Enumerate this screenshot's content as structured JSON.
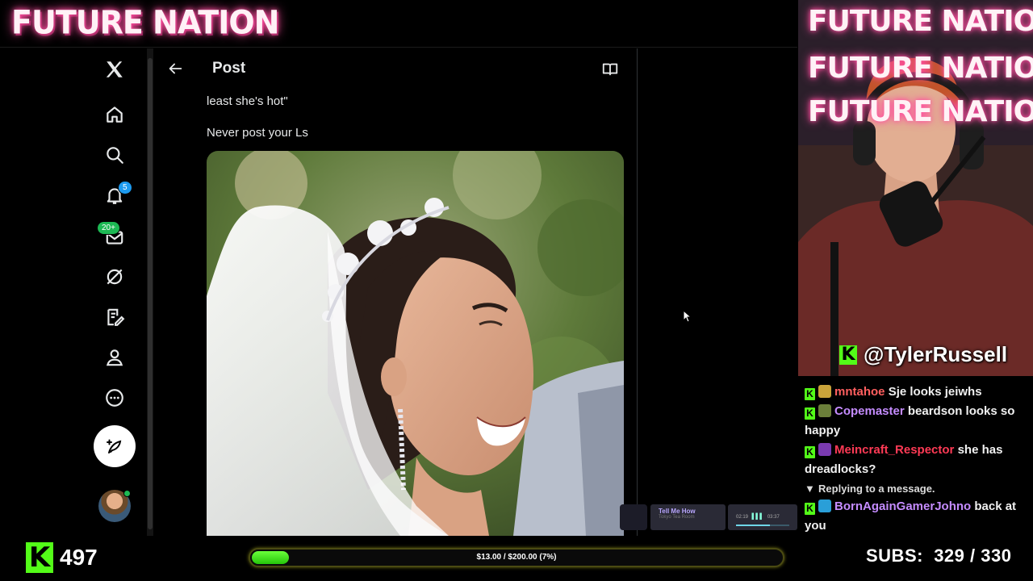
{
  "overlay": {
    "brand": "FUTURE NATION",
    "webcam_titles": [
      "FUTURE NATION",
      "FUTURE NATION",
      "FUTURE NATION"
    ],
    "streamer_handle": "@TylerRussell",
    "kick_followers": "497",
    "goal_text": "$13.00 / $200.00 (7%)",
    "goal_progress": 0.07,
    "subs_label": "SUBS:",
    "subs_value": "329 / 330",
    "accent_green": "#53fc18"
  },
  "nav": {
    "notifications_badge": "5",
    "messages_badge": "20+",
    "icons": [
      "x-logo-icon",
      "home-icon",
      "search-icon",
      "bell-icon",
      "mail-icon",
      "grok-icon",
      "edit-list-icon",
      "profile-icon",
      "more-icon",
      "compose-icon"
    ]
  },
  "post": {
    "title": "Post",
    "quote_text": "least she's hot\"",
    "body_text": "Never post your Ls"
  },
  "chat": {
    "messages": [
      {
        "user": "mntahoe",
        "color": "#ff5f5f",
        "text": "Sje looks jeiwhs"
      },
      {
        "user": "Copemaster",
        "color": "#c58cff",
        "text": "beardson looks so happy"
      },
      {
        "user": "Meincraft_Respector",
        "color": "#ff3a55",
        "text": "she has dreadlocks?"
      },
      {
        "reply": "Replying to a message."
      },
      {
        "user": "BornAgainGamerJohno",
        "color": "#c58cff",
        "text": "back at you"
      }
    ]
  },
  "mini_player": {
    "track": "Tell Me How",
    "artist": "Tokyo Tea Room",
    "time_elapsed": "02:19",
    "time_total": "03:37"
  }
}
